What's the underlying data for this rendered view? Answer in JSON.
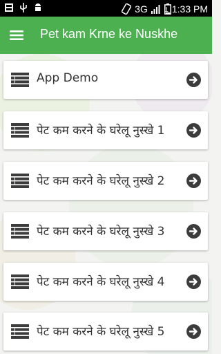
{
  "status_bar": {
    "network": "3G",
    "battery": "1",
    "time": "1:33 PM"
  },
  "app_bar": {
    "title": "Pet kam Krne ke Nuskhe",
    "menu_icon": "hamburger-menu-icon"
  },
  "list": {
    "items": [
      {
        "label": "App Demo"
      },
      {
        "label": "पेट कम करने के घरेलू नुस्खे 1"
      },
      {
        "label": "पेट कम करने के घरेलू नुस्खे 2"
      },
      {
        "label": "पेट कम करने के घरेलू नुस्खे 3"
      },
      {
        "label": "पेट कम करने के घरेलू नुस्खे 4"
      },
      {
        "label": "पेट कम करने के घरेलू नुस्खे 5"
      }
    ],
    "item_icon": "list-icon",
    "action_icon": "arrow-right-circle-icon"
  },
  "colors": {
    "app_bar": "#4caf50",
    "status_bar": "#000000",
    "card": "#ffffff",
    "text": "#333333",
    "icon": "#3c3c3c"
  }
}
